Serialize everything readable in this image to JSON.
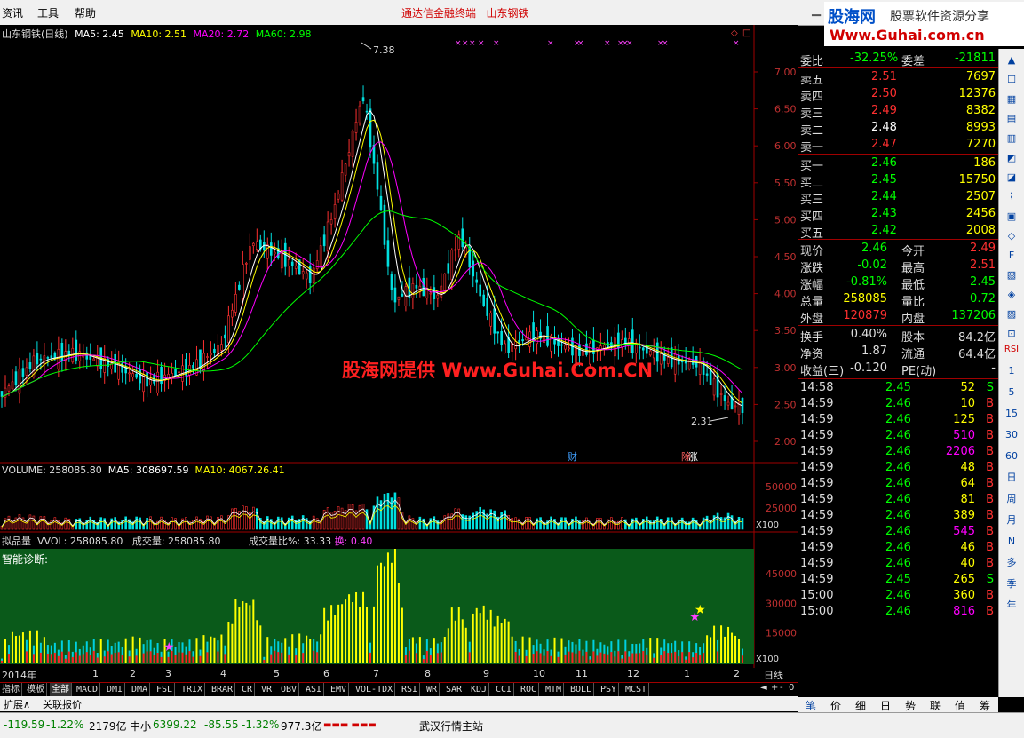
{
  "menu": {
    "items": [
      "资讯",
      "工具",
      "帮助"
    ],
    "center_title": "通达信金融终端",
    "stock_name": "山东钢铁"
  },
  "logo": {
    "main": "股海网",
    "sub": "股票软件资源分享",
    "url": "Www.Guhai.com.cn"
  },
  "watermark": "股海网提供 Www.Guhai.Com.CN",
  "price_chart": {
    "title_name": "山东钢铁(日线)",
    "ma": [
      {
        "label": "MA5: 2.45",
        "color": "#ffffff"
      },
      {
        "label": "MA10: 2.51",
        "color": "#ffff00"
      },
      {
        "label": "MA20: 2.72",
        "color": "#ff00ff"
      },
      {
        "label": "MA60: 2.98",
        "color": "#00ff00"
      }
    ],
    "y_ticks": [
      "7.00",
      "6.50",
      "6.00",
      "5.50",
      "5.00",
      "4.50",
      "4.00",
      "3.50",
      "3.00",
      "2.50",
      "2.00"
    ],
    "high_label": "7.38",
    "low_label": "2.31",
    "marker_cai": "财",
    "marker_fz": "除",
    "marker_zhang": "涨"
  },
  "volume_chart": {
    "title": "VOLUME: 258085.80",
    "ma5": "MA5: 308697.59",
    "ma10": "MA10: 4067.26.41",
    "y_ticks": [
      "50000",
      "25000"
    ],
    "unit": "X100"
  },
  "third_chart": {
    "name": "拟品量",
    "vvol": "VVOL: 258085.80",
    "vol": "成交量: 258085.80",
    "ratio": "成交量比%: 33.33",
    "huan": "换: 0.40",
    "diag": "智能诊断:",
    "y_ticks": [
      "45000",
      "30000",
      "15000"
    ],
    "unit": "X100"
  },
  "date_axis": {
    "labels": [
      "2014年",
      "1",
      "2",
      "3",
      "4",
      "5",
      "6",
      "7",
      "8",
      "9",
      "10",
      "11",
      "12",
      "1",
      "2"
    ],
    "period": "日线"
  },
  "quote": {
    "wb_label": "委比",
    "wb_value": "-32.25%",
    "wc_label": "委差",
    "wc_value": "-21811",
    "sells": [
      {
        "label": "卖五",
        "price": "2.51",
        "vol": "7697"
      },
      {
        "label": "卖四",
        "price": "2.50",
        "vol": "12376"
      },
      {
        "label": "卖三",
        "price": "2.49",
        "vol": "8382"
      },
      {
        "label": "卖二",
        "price": "2.48",
        "vol": "8993"
      },
      {
        "label": "卖一",
        "price": "2.47",
        "vol": "7270"
      }
    ],
    "buys": [
      {
        "label": "买一",
        "price": "2.46",
        "vol": "186"
      },
      {
        "label": "买二",
        "price": "2.45",
        "vol": "15750"
      },
      {
        "label": "买三",
        "price": "2.44",
        "vol": "2507"
      },
      {
        "label": "买四",
        "price": "2.43",
        "vol": "2456"
      },
      {
        "label": "买五",
        "price": "2.42",
        "vol": "2008"
      }
    ],
    "stats": [
      {
        "l1": "现价",
        "v1": "2.46",
        "c1": "#00ff00",
        "l2": "今开",
        "v2": "2.49",
        "c2": "#ff3030"
      },
      {
        "l1": "涨跌",
        "v1": "-0.02",
        "c1": "#00ff00",
        "l2": "最高",
        "v2": "2.51",
        "c2": "#ff3030"
      },
      {
        "l1": "涨幅",
        "v1": "-0.81%",
        "c1": "#00ff00",
        "l2": "最低",
        "v2": "2.45",
        "c2": "#00ff00"
      },
      {
        "l1": "总量",
        "v1": "258085",
        "c1": "#ffff00",
        "l2": "量比",
        "v2": "0.72",
        "c2": "#00ff00"
      },
      {
        "l1": "外盘",
        "v1": "120879",
        "c1": "#ff3030",
        "l2": "内盘",
        "v2": "137206",
        "c2": "#00ff00"
      }
    ],
    "stats2": [
      {
        "l1": "换手",
        "v1": "0.40%",
        "l2": "股本",
        "v2": "84.2亿"
      },
      {
        "l1": "净资",
        "v1": "1.87",
        "l2": "流通",
        "v2": "64.4亿"
      },
      {
        "l1": "收益(三)",
        "v1": "-0.120",
        "l2": "PE(动)",
        "v2": "-"
      }
    ],
    "ticks": [
      {
        "t": "14:58",
        "p": "2.45",
        "v": "52",
        "s": "S",
        "vc": "#ffff00",
        "sc": "#00ff00"
      },
      {
        "t": "14:59",
        "p": "2.46",
        "v": "10",
        "s": "B",
        "vc": "#ffff00",
        "sc": "#ff3030"
      },
      {
        "t": "14:59",
        "p": "2.46",
        "v": "125",
        "s": "B",
        "vc": "#ffff00",
        "sc": "#ff3030"
      },
      {
        "t": "14:59",
        "p": "2.46",
        "v": "510",
        "s": "B",
        "vc": "#ff00ff",
        "sc": "#ff3030"
      },
      {
        "t": "14:59",
        "p": "2.46",
        "v": "2206",
        "s": "B",
        "vc": "#ff00ff",
        "sc": "#ff3030"
      },
      {
        "t": "14:59",
        "p": "2.46",
        "v": "48",
        "s": "B",
        "vc": "#ffff00",
        "sc": "#ff3030"
      },
      {
        "t": "14:59",
        "p": "2.46",
        "v": "64",
        "s": "B",
        "vc": "#ffff00",
        "sc": "#ff3030"
      },
      {
        "t": "14:59",
        "p": "2.46",
        "v": "81",
        "s": "B",
        "vc": "#ffff00",
        "sc": "#ff3030"
      },
      {
        "t": "14:59",
        "p": "2.46",
        "v": "389",
        "s": "B",
        "vc": "#ffff00",
        "sc": "#ff3030"
      },
      {
        "t": "14:59",
        "p": "2.46",
        "v": "545",
        "s": "B",
        "vc": "#ff00ff",
        "sc": "#ff3030"
      },
      {
        "t": "14:59",
        "p": "2.46",
        "v": "46",
        "s": "B",
        "vc": "#ffff00",
        "sc": "#ff3030"
      },
      {
        "t": "14:59",
        "p": "2.46",
        "v": "40",
        "s": "B",
        "vc": "#ffff00",
        "sc": "#ff3030"
      },
      {
        "t": "14:59",
        "p": "2.45",
        "v": "265",
        "s": "S",
        "vc": "#ffff00",
        "sc": "#00ff00"
      },
      {
        "t": "15:00",
        "p": "2.46",
        "v": "360",
        "s": "B",
        "vc": "#ffff00",
        "sc": "#ff3030"
      },
      {
        "t": "15:00",
        "p": "2.46",
        "v": "816",
        "s": "B",
        "vc": "#ff00ff",
        "sc": "#ff3030"
      }
    ]
  },
  "toolbar": {
    "buttons": [
      "RSI",
      "1",
      "5",
      "15",
      "30",
      "60",
      "日",
      "周",
      "月",
      "N",
      "多",
      "季",
      "年"
    ]
  },
  "indicator_tabs": [
    "指标",
    "模板",
    "全部",
    "MACD",
    "DMI",
    "DMA",
    "FSL",
    "TRIX",
    "BRAR",
    "CR",
    "VR",
    "OBV",
    "ASI",
    "EMV",
    "VOL-TDX",
    "RSI",
    "WR",
    "SAR",
    "KDJ",
    "CCI",
    "ROC",
    "MTM",
    "BOLL",
    "PSY",
    "MCST"
  ],
  "sub_tabs": [
    "扩展∧",
    "关联报价"
  ],
  "right_tabs": [
    "笔",
    "价",
    "细",
    "日",
    "势",
    "联",
    "值",
    "筹"
  ],
  "nav_symbols": [
    "◄",
    "+",
    "-",
    "0"
  ],
  "status": {
    "sh_idx": "-119.59",
    "sh_pct": "-1.22%",
    "sh_amt": "2179亿",
    "zx_label": "中小",
    "zx_idx": "6399.22",
    "zx_chg": "-85.55",
    "zx_pct": "-1.32%",
    "zx_amt": "977.3亿",
    "station": "武汉行情主站"
  }
}
